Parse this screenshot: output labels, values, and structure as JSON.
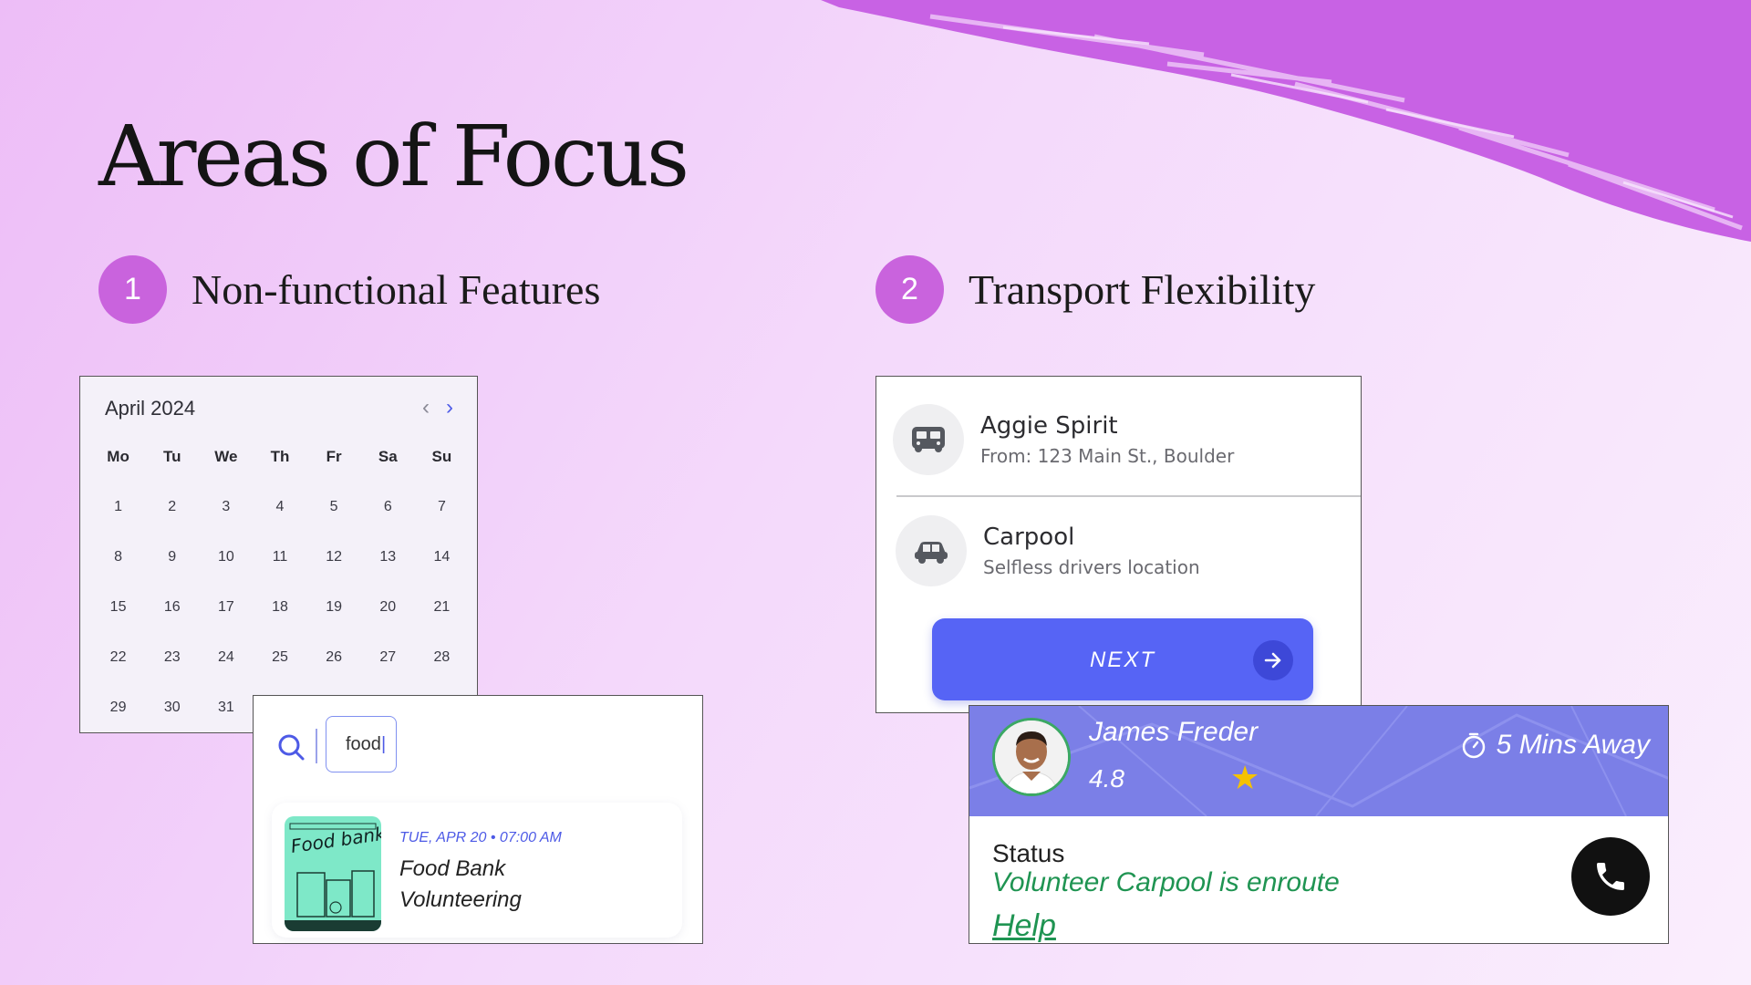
{
  "slide": {
    "title": "Areas of Focus",
    "accent_color": "#c963dd",
    "focus_areas": [
      {
        "number": "1",
        "label": "Non-functional Features"
      },
      {
        "number": "2",
        "label": "Transport Flexibility"
      }
    ]
  },
  "calendar": {
    "month_label": "April 2024",
    "prev_icon": "chevron-left-icon",
    "next_icon": "chevron-right-icon",
    "weekdays": [
      "Mo",
      "Tu",
      "We",
      "Th",
      "Fr",
      "Sa",
      "Su"
    ],
    "days": [
      "1",
      "2",
      "3",
      "4",
      "5",
      "6",
      "7",
      "8",
      "9",
      "10",
      "11",
      "12",
      "13",
      "14",
      "15",
      "16",
      "17",
      "18",
      "19",
      "20",
      "21",
      "22",
      "23",
      "24",
      "25",
      "26",
      "27",
      "28",
      "29",
      "30",
      "31"
    ]
  },
  "search": {
    "icon": "search-icon",
    "value": "food",
    "result": {
      "date": "TUE, APR 20 • 07:00 AM",
      "title": "Food Bank Volunteering",
      "thumbnail_text": "Food bank"
    }
  },
  "transport": {
    "options": [
      {
        "icon": "bus-icon",
        "title": "Aggie Spirit",
        "subtitle": "From: 123 Main St., Boulder"
      },
      {
        "icon": "car-icon",
        "title": "Carpool",
        "subtitle": "Selfless drivers location"
      }
    ],
    "next_label": "NEXT",
    "button_color": "#5664f5"
  },
  "driver": {
    "name": "James Freder",
    "rating": "4.8",
    "eta": "5 Mins Away",
    "status_label": "Status",
    "status_text": "Volunteer Carpool is enroute",
    "help_label": "Help",
    "status_color": "#1f9452",
    "header_color": "#7b7fe7"
  }
}
